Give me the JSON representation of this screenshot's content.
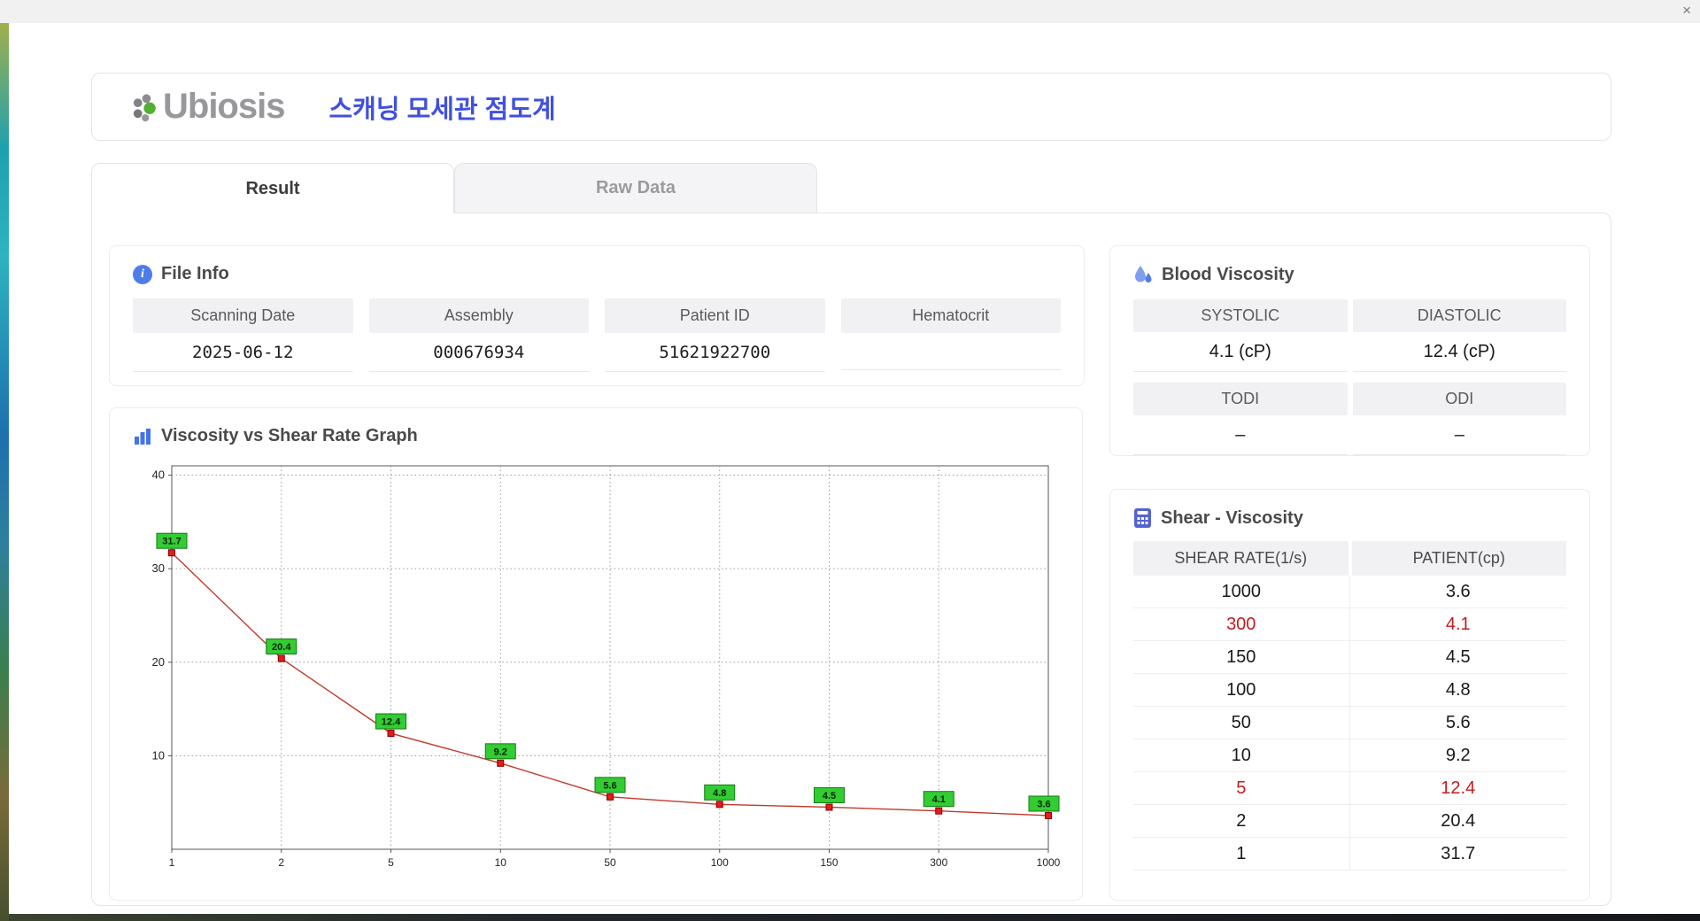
{
  "window": {
    "close_label": "×"
  },
  "header": {
    "logo_text": "Ubiosis",
    "title": "스캐닝 모세관 점도계"
  },
  "tabs": [
    {
      "label": "Result",
      "active": true
    },
    {
      "label": "Raw Data",
      "active": false
    }
  ],
  "file_info": {
    "heading": "File Info",
    "fields": [
      {
        "label": "Scanning Date",
        "value": "2025-06-12"
      },
      {
        "label": "Assembly",
        "value": "000676934"
      },
      {
        "label": "Patient ID",
        "value": "51621922700"
      },
      {
        "label": "Hematocrit",
        "value": ""
      }
    ]
  },
  "graph": {
    "heading": "Viscosity vs Shear Rate Graph"
  },
  "chart_data": {
    "type": "line",
    "title": "Viscosity vs Shear Rate Graph",
    "x_axis_type": "category",
    "categories": [
      "1",
      "2",
      "5",
      "10",
      "50",
      "100",
      "150",
      "300",
      "1000"
    ],
    "values": [
      31.7,
      20.4,
      12.4,
      9.2,
      5.6,
      4.8,
      4.5,
      4.1,
      3.6
    ],
    "xlabel": "",
    "ylabel": "",
    "ylim": [
      0,
      41
    ],
    "yticks": [
      10,
      20,
      30,
      40
    ],
    "grid": true,
    "legend": "none",
    "line_color": "#c0392b",
    "marker_color": "#e31b1b",
    "marker_edge": "#8a0000",
    "label_bg": "#33cc33",
    "label_edge": "#117a11"
  },
  "blood_viscosity": {
    "heading": "Blood Viscosity",
    "cells": [
      {
        "label": "SYSTOLIC",
        "value": "4.1 (cP)"
      },
      {
        "label": "DIASTOLIC",
        "value": "12.4 (cP)"
      },
      {
        "label": "TODI",
        "value": "–"
      },
      {
        "label": "ODI",
        "value": "–"
      }
    ]
  },
  "shear_viscosity": {
    "heading": "Shear - Viscosity",
    "columns": [
      "SHEAR RATE(1/s)",
      "PATIENT(cp)"
    ],
    "rows": [
      {
        "rate": "1000",
        "patient": "3.6",
        "highlight": false
      },
      {
        "rate": "300",
        "patient": "4.1",
        "highlight": true
      },
      {
        "rate": "150",
        "patient": "4.5",
        "highlight": false
      },
      {
        "rate": "100",
        "patient": "4.8",
        "highlight": false
      },
      {
        "rate": "50",
        "patient": "5.6",
        "highlight": false
      },
      {
        "rate": "10",
        "patient": "9.2",
        "highlight": false
      },
      {
        "rate": "5",
        "patient": "12.4",
        "highlight": true
      },
      {
        "rate": "2",
        "patient": "20.4",
        "highlight": false
      },
      {
        "rate": "1",
        "patient": "31.7",
        "highlight": false
      }
    ]
  }
}
